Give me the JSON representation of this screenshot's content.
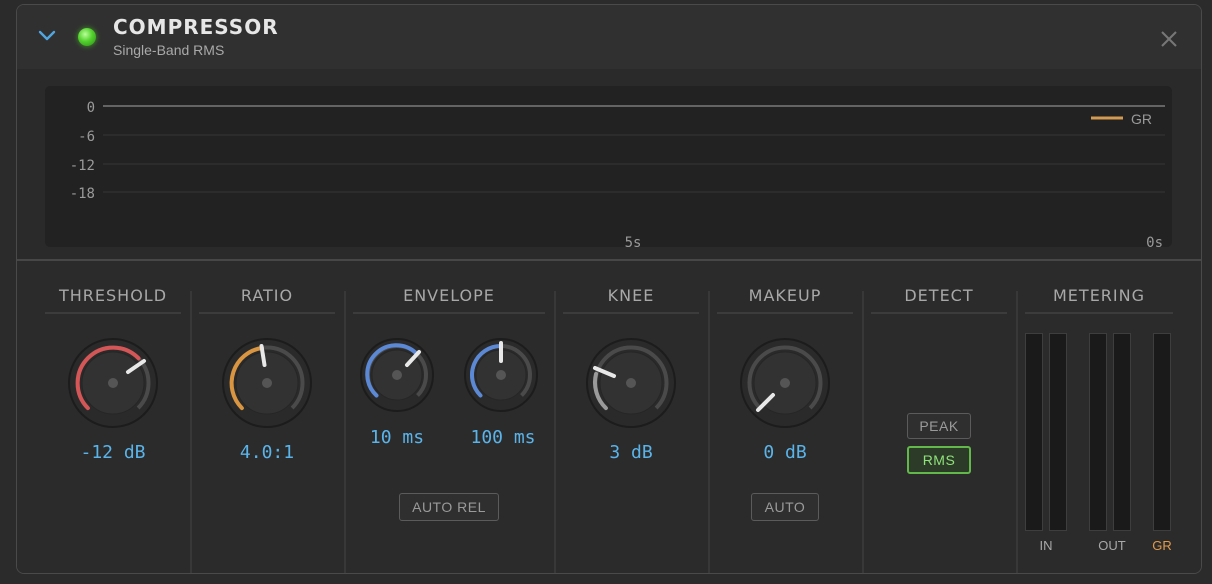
{
  "header": {
    "title": "COMPRESSOR",
    "subtitle": "Single-Band RMS",
    "enabled": true
  },
  "graph": {
    "y_ticks": [
      "0",
      "-6",
      "-12",
      "-18"
    ],
    "x_ticks": [
      "5s",
      "0s"
    ],
    "legend": "GR",
    "legend_color": "#d39a52"
  },
  "sections": {
    "threshold": {
      "title": "THRESHOLD",
      "value": "-12 dB",
      "color": "#d45656"
    },
    "ratio": {
      "title": "RATIO",
      "value": "4.0:1",
      "color": "#d9953f"
    },
    "envelope": {
      "title": "ENVELOPE",
      "attack_value": "10 ms",
      "release_value": "100 ms",
      "auto_rel_label": "AUTO REL",
      "color": "#5b89d6"
    },
    "knee": {
      "title": "KNEE",
      "value": "3 dB",
      "color": "#9a9a9a"
    },
    "makeup": {
      "title": "MAKEUP",
      "value": "0 dB",
      "auto_label": "AUTO"
    },
    "detect": {
      "title": "DETECT",
      "peak_label": "PEAK",
      "rms_label": "RMS",
      "selected": "RMS"
    },
    "metering": {
      "title": "METERING",
      "in_label": "IN",
      "out_label": "OUT",
      "gr_label": "GR",
      "gr_color": "#e39a4a"
    }
  }
}
